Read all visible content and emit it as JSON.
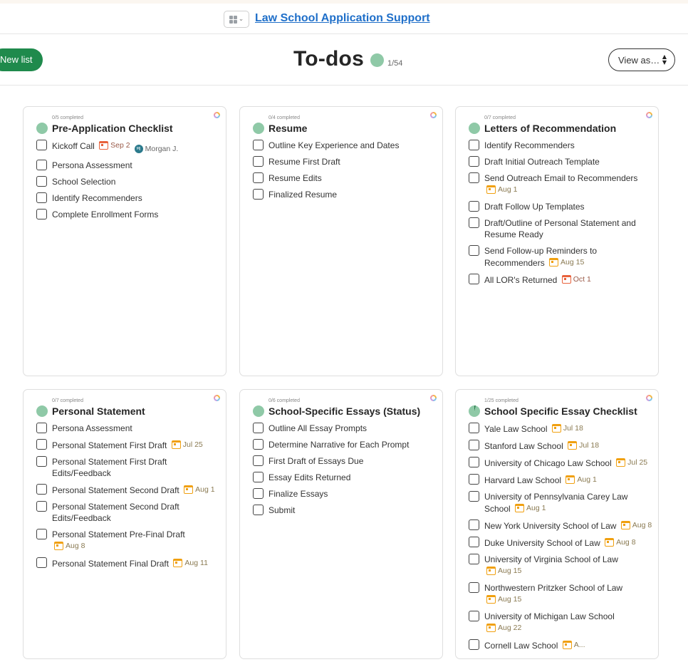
{
  "project": {
    "title": "Law School Application Support"
  },
  "header": {
    "new_list_label": "New list",
    "title": "To-dos",
    "progress_count": "1/54",
    "view_as_label": "View as…"
  },
  "lists": [
    {
      "count_label": "0/5 completed",
      "title": "Pre-Application Checklist",
      "items": [
        {
          "text": "Kickoff Call",
          "due": "Sep 2",
          "due_style": "overdue",
          "assignee": "Morgan J.",
          "assignee_initials": "MJ"
        },
        {
          "text": "Persona Assessment"
        },
        {
          "text": "School Selection"
        },
        {
          "text": "Identify Recommenders"
        },
        {
          "text": "Complete Enrollment Forms"
        }
      ]
    },
    {
      "count_label": "0/4 completed",
      "title": "Resume",
      "items": [
        {
          "text": "Outline Key Experience and Dates"
        },
        {
          "text": "Resume First Draft"
        },
        {
          "text": "Resume Edits"
        },
        {
          "text": "Finalized Resume"
        }
      ]
    },
    {
      "count_label": "0/7 completed",
      "title": "Letters of Recommendation",
      "items": [
        {
          "text": "Identify Recommenders"
        },
        {
          "text": "Draft Initial Outreach Template"
        },
        {
          "text": "Send Outreach Email to Recommenders",
          "due": "Aug 1"
        },
        {
          "text": "Draft Follow Up Templates"
        },
        {
          "text": "Draft/Outline of Personal Statement and Resume Ready"
        },
        {
          "text": "Send Follow-up Reminders to Recommenders",
          "due": "Aug 15"
        },
        {
          "text": "All LOR's Returned",
          "due": "Oct 1",
          "due_style": "overdue"
        }
      ]
    },
    {
      "count_label": "0/7 completed",
      "title": "Personal Statement",
      "items": [
        {
          "text": "Persona Assessment"
        },
        {
          "text": "Personal Statement First Draft",
          "due": "Jul 25"
        },
        {
          "text": "Personal Statement First Draft Edits/Feedback"
        },
        {
          "text": "Personal Statement Second Draft",
          "due": "Aug 1"
        },
        {
          "text": "Personal Statement Second Draft Edits/Feedback"
        },
        {
          "text": "Personal Statement Pre-Final Draft",
          "due": "Aug 8"
        },
        {
          "text": "Personal Statement Final Draft",
          "due": "Aug 11"
        }
      ]
    },
    {
      "count_label": "0/6 completed",
      "title": "School-Specific Essays (Status)",
      "items": [
        {
          "text": "Outline All Essay Prompts"
        },
        {
          "text": "Determine Narrative for Each Prompt"
        },
        {
          "text": "First Draft of Essays Due"
        },
        {
          "text": "Essay Edits Returned"
        },
        {
          "text": "Finalize Essays"
        },
        {
          "text": "Submit"
        }
      ]
    },
    {
      "count_label": "1/25 completed",
      "title": "School Specific Essay Checklist",
      "items": [
        {
          "text": "Yale Law School",
          "due": "Jul 18"
        },
        {
          "text": "Stanford Law School",
          "due": "Jul 18"
        },
        {
          "text": "University of Chicago Law School",
          "due": "Jul 25"
        },
        {
          "text": "Harvard Law School",
          "due": "Aug 1"
        },
        {
          "text": "University of Pennsylvania Carey Law School",
          "due": "Aug 1"
        },
        {
          "text": "New York University School of Law",
          "due": "Aug 8"
        },
        {
          "text": "Duke University School of Law",
          "due": "Aug 8"
        },
        {
          "text": "University of Virginia School of Law",
          "due": "Aug 15"
        },
        {
          "text": "Northwestern Pritzker School of Law",
          "due": "Aug 15"
        },
        {
          "text": "University of Michigan Law School",
          "due": "Aug 22"
        },
        {
          "text": "Cornell Law School",
          "due": "A..."
        }
      ]
    }
  ]
}
